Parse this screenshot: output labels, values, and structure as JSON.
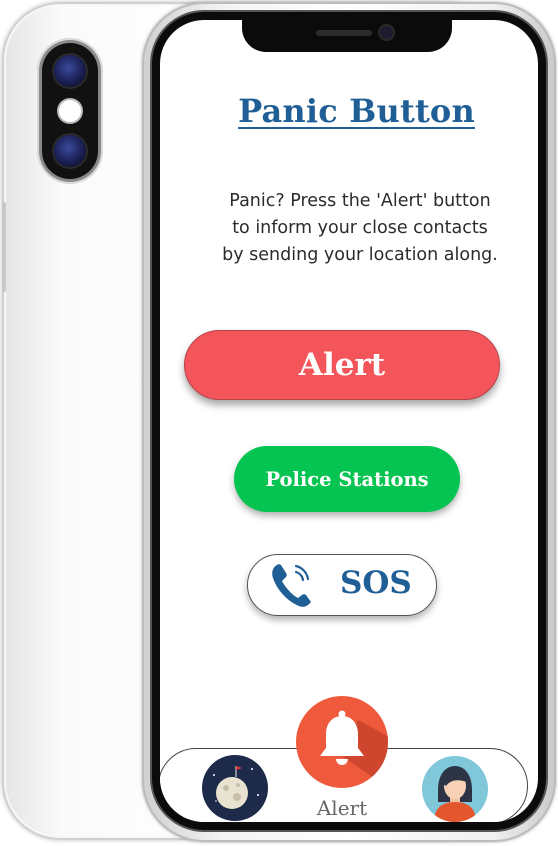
{
  "app": {
    "title": "Panic Button",
    "description_lines": [
      "Panic? Press the 'Alert' button",
      "to inform your close contacts",
      "by sending your location along."
    ]
  },
  "buttons": {
    "alert_label": "Alert",
    "police_label": "Police Stations",
    "sos_label": "SOS"
  },
  "bottom_nav": {
    "left_icon": "moon-icon",
    "center_icon": "bell-icon",
    "center_label": "Alert",
    "right_icon": "user-avatar-icon"
  },
  "colors": {
    "title": "#1f5f96",
    "alert_button": "#f4555a",
    "police_button": "#06c451",
    "sos_text": "#1f5f96",
    "bell_circle": "#ef5a3c"
  }
}
